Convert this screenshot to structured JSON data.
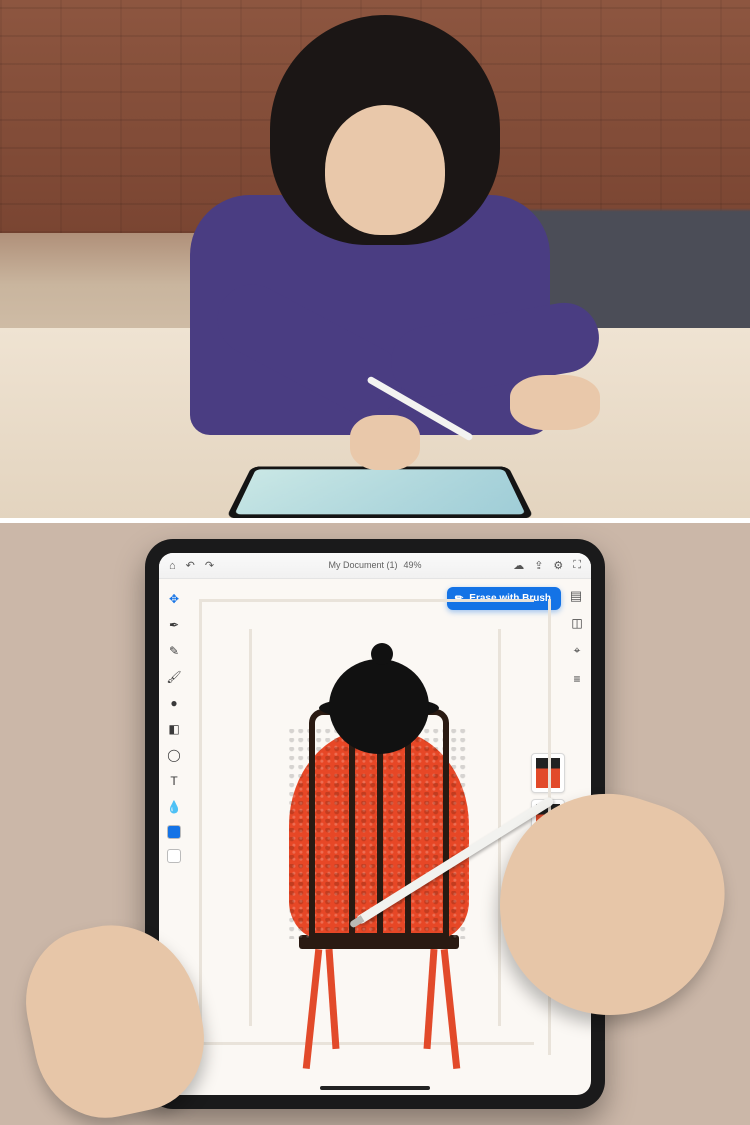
{
  "app": {
    "document_title": "My Document (1)",
    "zoom": "49%",
    "action_button_label": "Erase with Brush"
  },
  "topbar": {
    "home_icon": "home-icon",
    "undo_icon": "undo-icon",
    "redo_icon": "redo-icon",
    "cloud_icon": "cloud-icon",
    "share_icon": "share-icon",
    "settings_icon": "settings-icon",
    "layers_icon": "layers-icon",
    "fullscreen_icon": "fullscreen-icon"
  },
  "tools": [
    {
      "name": "move-tool",
      "glyph": "✥"
    },
    {
      "name": "pen-tool",
      "glyph": "✒"
    },
    {
      "name": "pencil-tool",
      "glyph": "✎"
    },
    {
      "name": "brush-tool",
      "glyph": "🖌"
    },
    {
      "name": "blob-brush-tool",
      "glyph": "●"
    },
    {
      "name": "eraser-tool",
      "glyph": "◧"
    },
    {
      "name": "shape-tool",
      "glyph": "◯"
    },
    {
      "name": "type-tool",
      "glyph": "T"
    },
    {
      "name": "eyedropper-tool",
      "glyph": "💧"
    }
  ],
  "colors": {
    "fill": "#1473e6",
    "stroke": "#ffffff"
  },
  "right_rail": [
    {
      "name": "properties-icon",
      "glyph": "◫"
    },
    {
      "name": "precision-icon",
      "glyph": "⌖"
    },
    {
      "name": "align-icon",
      "glyph": "≡"
    }
  ],
  "scene": {
    "top_description": "Artist drawing on a tablet with a stylus at a wooden desk",
    "bottom_description": "Top-down view of tablet running drawing app with figure illustration"
  }
}
